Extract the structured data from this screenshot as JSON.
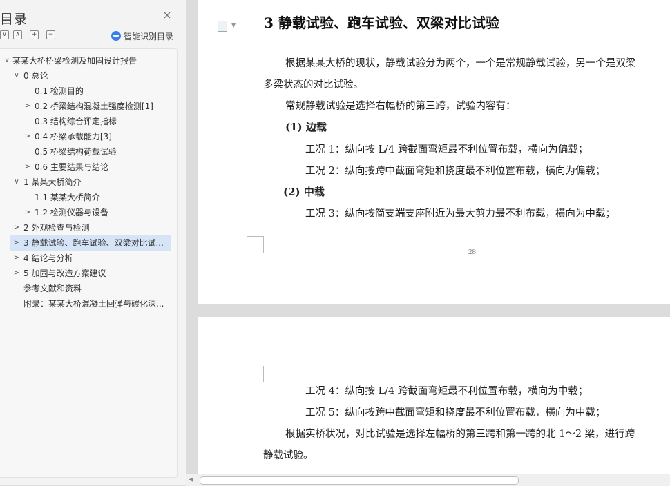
{
  "sidebar": {
    "title": "目录",
    "close_icon": "×",
    "tools": [
      "∨",
      "∧",
      "+",
      "−"
    ],
    "ai_label": "智能识别目录",
    "toc": [
      {
        "text": "某某大桥桥梁检测及加固设计报告",
        "level": 0,
        "arrow": "∨"
      },
      {
        "text": "0  总论",
        "level": 1,
        "arrow": "∨"
      },
      {
        "text": "0.1  检测目的",
        "level": 2,
        "arrow": ""
      },
      {
        "text": "0.2  桥梁结构混凝土强度检测[1]",
        "level": 2,
        "arrow": ">"
      },
      {
        "text": "0.3  结构综合评定指标",
        "level": 2,
        "arrow": ""
      },
      {
        "text": "0.4 桥梁承载能力[3]",
        "level": 2,
        "arrow": ">"
      },
      {
        "text": "0.5  桥梁结构荷载试验",
        "level": 2,
        "arrow": ""
      },
      {
        "text": "0.6  主要结果与结论",
        "level": 2,
        "arrow": ">"
      },
      {
        "text": "1 某某大桥简介",
        "level": 1,
        "arrow": "∨"
      },
      {
        "text": "1.1 某某大桥简介",
        "level": 2,
        "arrow": ""
      },
      {
        "text": "1.2  检测仪器与设备",
        "level": 2,
        "arrow": ">"
      },
      {
        "text": "2  外观检查与检测",
        "level": 1,
        "arrow": ">"
      },
      {
        "text": "3  静载试验、跑车试验、双梁对比试...",
        "level": 1,
        "arrow": ">",
        "selected": true
      },
      {
        "text": "4  结论与分析",
        "level": 1,
        "arrow": ">"
      },
      {
        "text": "5  加固与改造方案建议",
        "level": 1,
        "arrow": ">"
      },
      {
        "text": "参考文献和资料",
        "level": 1,
        "arrow": ""
      },
      {
        "text": "附录：某某大桥混凝土回弹与碳化深...",
        "level": 1,
        "arrow": ""
      }
    ]
  },
  "document": {
    "heading": "3  静载试验、跑车试验、双梁对比试验",
    "page1_lines": [
      "根据某某大桥的现状，静载试验分为两个，一个是常规静载试验，另一个是双梁",
      "多梁状态的对比试验。",
      "常规静载试验是选择右幅桥的第三跨，试验内容有：",
      "(1)  边载",
      "工况 1：纵向按 L/4 跨截面弯矩最不利位置布载，横向为偏载；",
      "工况 2：纵向按跨中截面弯矩和挠度最不利位置布载，横向为偏载；",
      "(2)  中载",
      "工况 3：纵向按简支端支座附近为最大剪力最不利布载，横向为中载；"
    ],
    "page_number": "28",
    "page2_lines": [
      "工况 4：纵向按 L/4 跨截面弯矩最不利位置布载，横向为中载；",
      "工况 5：纵向按跨中截面弯矩和挠度最不利位置布载，横向为中载；",
      "根据实桥状况，对比试验是选择左幅桥的第三跨和第一跨的北 1～2 梁，进行跨",
      "静载试验。"
    ]
  },
  "icons": {
    "close": "close-icon",
    "ai": "smart-recognize-icon",
    "page": "page-icon"
  }
}
